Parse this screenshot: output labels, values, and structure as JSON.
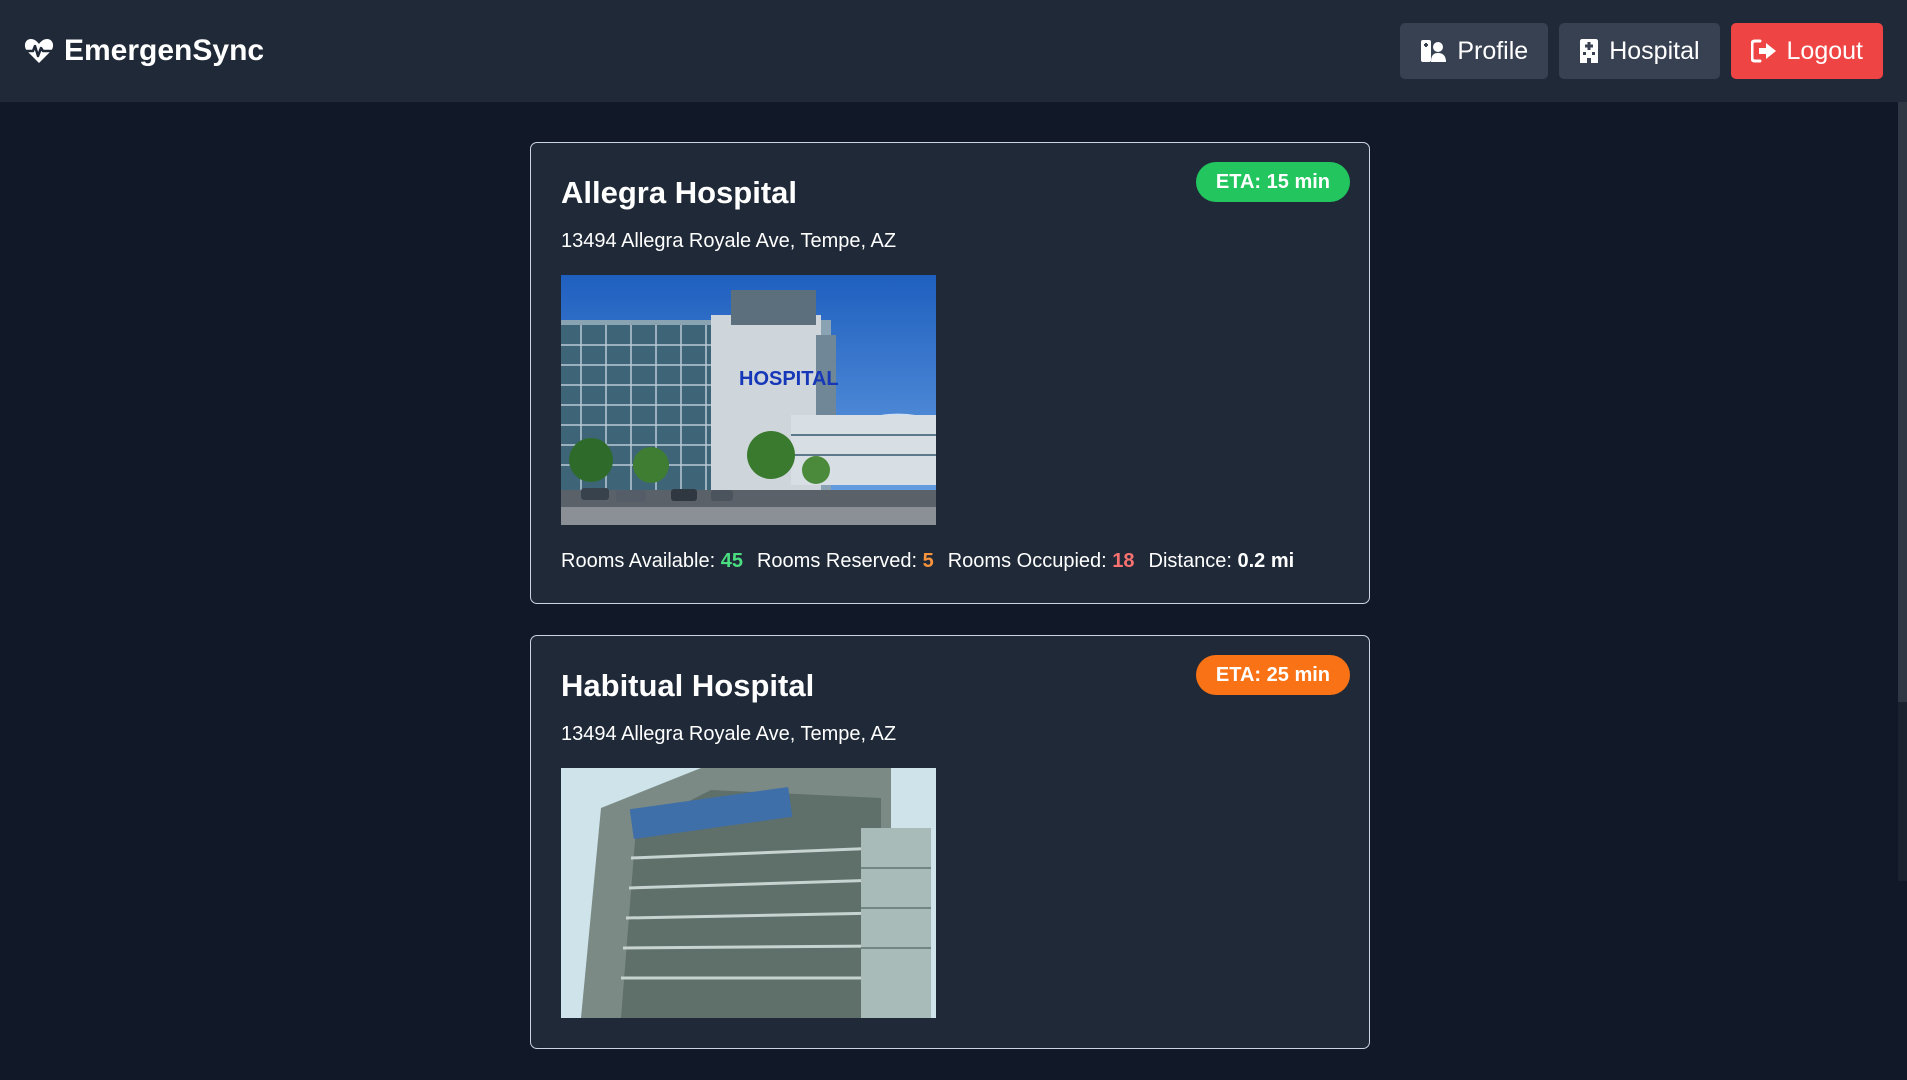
{
  "app": {
    "title": "EmergenSync",
    "logo_icon": "heart-pulse-icon"
  },
  "nav": {
    "profile_label": "Profile",
    "profile_icon": "hospital-user-icon",
    "hospital_label": "Hospital",
    "hospital_icon": "hospital-icon",
    "logout_label": "Logout",
    "logout_icon": "sign-out-icon"
  },
  "colors": {
    "page_background": "#111827",
    "panel_background": "#1f2937",
    "eta_green": "#22c55e",
    "eta_orange": "#f97316",
    "logout_red": "#ef4444",
    "available": "#4ade80",
    "reserved": "#fb923c",
    "occupied": "#f87171"
  },
  "hospitals": [
    {
      "name": "Allegra Hospital",
      "address": "13494 Allegra Royale Ave, Tempe, AZ",
      "eta_label": "ETA:",
      "eta_value": "15 min",
      "image_text": "HOSPITAL",
      "stats": {
        "available_label": "Rooms Available:",
        "available_value": "45",
        "reserved_label": "Rooms Reserved:",
        "reserved_value": "5",
        "occupied_label": "Rooms Occupied:",
        "occupied_value": "18",
        "distance_label": "Distance:",
        "distance_value": "0.2 mi"
      }
    },
    {
      "name": "Habitual Hospital",
      "address": "13494 Allegra Royale Ave, Tempe, AZ",
      "eta_label": "ETA:",
      "eta_value": "25 min"
    }
  ]
}
